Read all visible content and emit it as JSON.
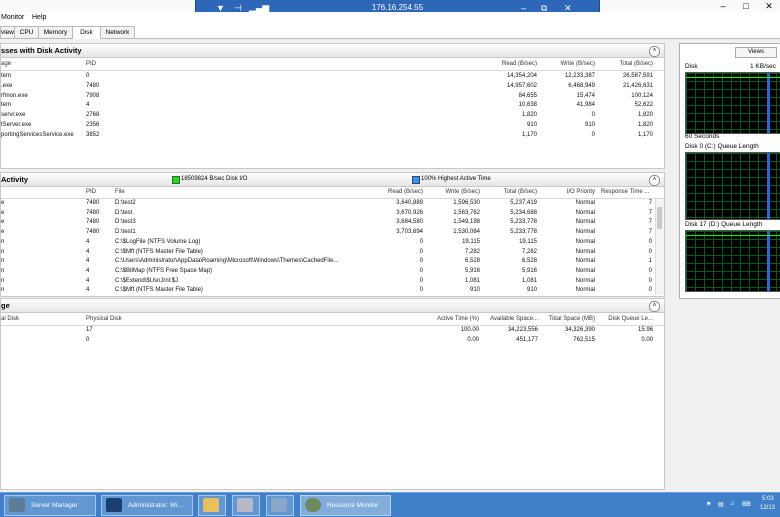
{
  "rdp": {
    "ip": "176.16.254.55"
  },
  "menu": [
    "Monitor",
    "Help"
  ],
  "tabs": [
    "view",
    "CPU",
    "Memory",
    "Disk",
    "Network"
  ],
  "active_tab": "Disk",
  "processes": {
    "title": "sses with Disk Activity",
    "columns": [
      "age",
      "PID",
      "Read (B/sec)",
      "Write (B/sec)",
      "Total (B/sec)"
    ],
    "rows": [
      [
        "tem",
        "0",
        "14,354,204",
        "12,233,387",
        "26,587,591"
      ],
      [
        ".exe",
        "7480",
        "14,957,602",
        "6,468,949",
        "21,426,631"
      ],
      [
        "rfmon.exe",
        "7908",
        "84,655",
        "15,474",
        "100,124"
      ],
      [
        "tem",
        "4",
        "10,638",
        "41,984",
        "52,622"
      ],
      [
        "servr.exe",
        "2768",
        "1,820",
        "0",
        "1,820"
      ],
      [
        "tServer.exe",
        "2356",
        "910",
        "910",
        "1,820"
      ],
      [
        "portingServicesService.exe",
        "3852",
        "1,170",
        "0",
        "1,170"
      ]
    ]
  },
  "activity": {
    "title": "Activity",
    "legend1": "18509824 B/sec Disk I/O",
    "legend2": "100% Highest Active Time",
    "columns": [
      "",
      "PID",
      "File",
      "Read (B/sec)",
      "Write (B/sec)",
      "Total (B/sec)",
      "I/O Priority",
      "Response Time ..."
    ],
    "rows": [
      [
        "e",
        "7480",
        "D:\\test2",
        "3,640,889",
        "1,596,530",
        "5,237,419",
        "Normal",
        "7"
      ],
      [
        "e",
        "7480",
        "D:\\test",
        "3,670,926",
        "1,563,762",
        "5,234,688",
        "Normal",
        "7"
      ],
      [
        "e",
        "7480",
        "D:\\test3",
        "3,684,580",
        "1,549,198",
        "5,233,778",
        "Normal",
        "7"
      ],
      [
        "e",
        "7480",
        "D:\\test1",
        "3,703,694",
        "1,530,084",
        "5,233,778",
        "Normal",
        "7"
      ],
      [
        "n",
        "4",
        "C:\\$LogFile (NTFS Volume Log)",
        "0",
        "19,115",
        "19,115",
        "Normal",
        "0"
      ],
      [
        "n",
        "4",
        "C:\\$Mft (NTFS Master File Table)",
        "0",
        "7,282",
        "7,282",
        "Normal",
        "0"
      ],
      [
        "n",
        "4",
        "C:\\Users\\Administrator\\AppData\\Roaming\\Microsoft\\Windows\\Themes\\CachedFile...",
        "0",
        "6,528",
        "6,528",
        "Normal",
        "1"
      ],
      [
        "n",
        "4",
        "C:\\$BitMap (NTFS Free Space Map)",
        "0",
        "5,916",
        "5,916",
        "Normal",
        "0"
      ],
      [
        "n",
        "4",
        "C:\\$Extend\\$UsnJrnl:$J",
        "0",
        "1,081",
        "1,081",
        "Normal",
        "0"
      ],
      [
        "n",
        "4",
        "C:\\$Mft (NTFS Master File Table)",
        "0",
        "910",
        "910",
        "Normal",
        "0"
      ]
    ]
  },
  "storage": {
    "title": "ge",
    "columns": [
      "al Disk",
      "Physical Disk",
      "Active Time (%)",
      "Available Space...",
      "Total Space (MB)",
      "Disk Queue Le..."
    ],
    "rows": [
      [
        "",
        "17",
        "100.00",
        "34,223,556",
        "34,326,390",
        "15.96"
      ],
      [
        "",
        "0",
        "0.00",
        "451,177",
        "762,515",
        "0.00"
      ]
    ]
  },
  "right_pane": {
    "views": "Views",
    "disk_label": "Disk",
    "disk_scale": "1 KB/sec",
    "time_label": "60 Seconds",
    "q0_label": "Disk 0 (C:) Queue Length",
    "q17_label": "Disk 17 (D:) Queue Length"
  },
  "taskbar": {
    "items": [
      "Server Manager",
      "Administrator: Wi...",
      "",
      "",
      "",
      "Resource Monitor"
    ],
    "clock": "5:03",
    "date": "12/13"
  },
  "colors": {
    "rdp_bar": "#2e67b8",
    "taskbar": "#3f80c8",
    "graph_line": "#00ff00",
    "graph_bg": "#000000",
    "legend_green": "#33cc33",
    "legend_blue": "#4a90d9"
  }
}
